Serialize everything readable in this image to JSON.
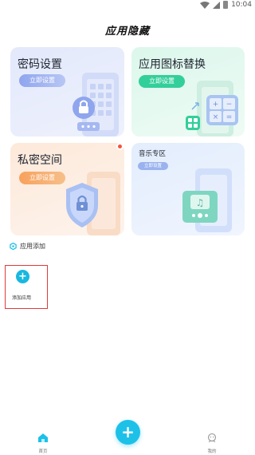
{
  "status_bar": {
    "time": "10:04"
  },
  "app": {
    "title": "应用隐藏"
  },
  "cards": {
    "password": {
      "title": "密码设置",
      "button": "立即设置"
    },
    "icon_replace": {
      "title": "应用图标替换",
      "button": "立即设置"
    },
    "private_space": {
      "title": "私密空间",
      "button": "立即设置"
    },
    "music": {
      "title": "音乐专区",
      "button": "立即设置"
    }
  },
  "section": {
    "title": "应用添加"
  },
  "add_app": {
    "label": "添加应用"
  },
  "bottom_nav": {
    "home_label": "首页",
    "mine_label": "我的",
    "fab_symbol": "+"
  },
  "colors": {
    "accent": "#1dc1e8",
    "password_btn": "#8fa5ee",
    "icon_btn": "#33cf9a",
    "private_btn": "#f8a15d",
    "music_btn": "#9ab3ef",
    "badge": "#f2553b",
    "highlight_box": "#e23a3a"
  }
}
